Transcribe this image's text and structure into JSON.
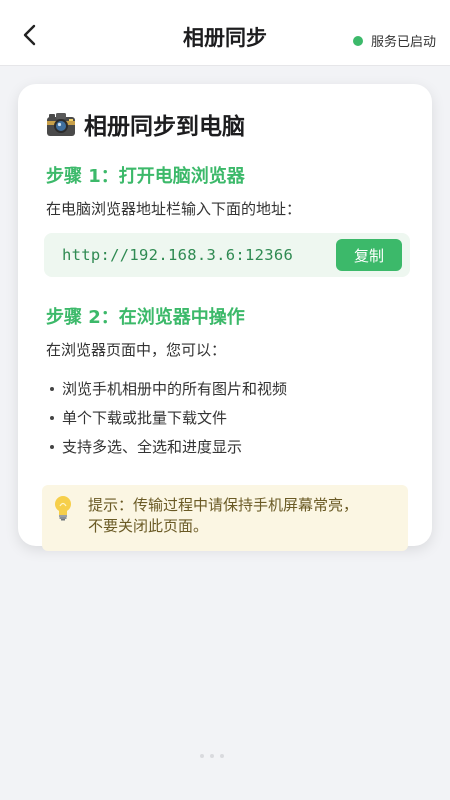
{
  "header": {
    "title": "相册同步",
    "back_icon": "chevron-left-icon",
    "status_text": "服务已启动",
    "status_color": "#3cb96a"
  },
  "card": {
    "title": "相册同步到电脑",
    "title_icon": "camera-icon",
    "step1": {
      "title": "步骤 1：打开电脑浏览器",
      "desc": "在电脑浏览器地址栏输入下面的地址：",
      "url": "http://192.168.3.6:12366",
      "copy_label": "复制"
    },
    "step2": {
      "title": "步骤 2：在浏览器中操作",
      "desc": "在浏览器页面中，您可以：",
      "features": [
        "浏览手机相册中的所有图片和视频",
        "单个下载或批量下载文件",
        "支持多选、全选和进度显示"
      ]
    },
    "tip": {
      "icon": "lightbulb-icon",
      "text_line1": "提示：传输过程中请保持手机屏幕常亮，",
      "text_line2": "不要关闭此页面。"
    }
  },
  "colors": {
    "accent": "#3cb96a",
    "url_background": "#eef7f0",
    "tip_background": "#fbf6e3"
  }
}
